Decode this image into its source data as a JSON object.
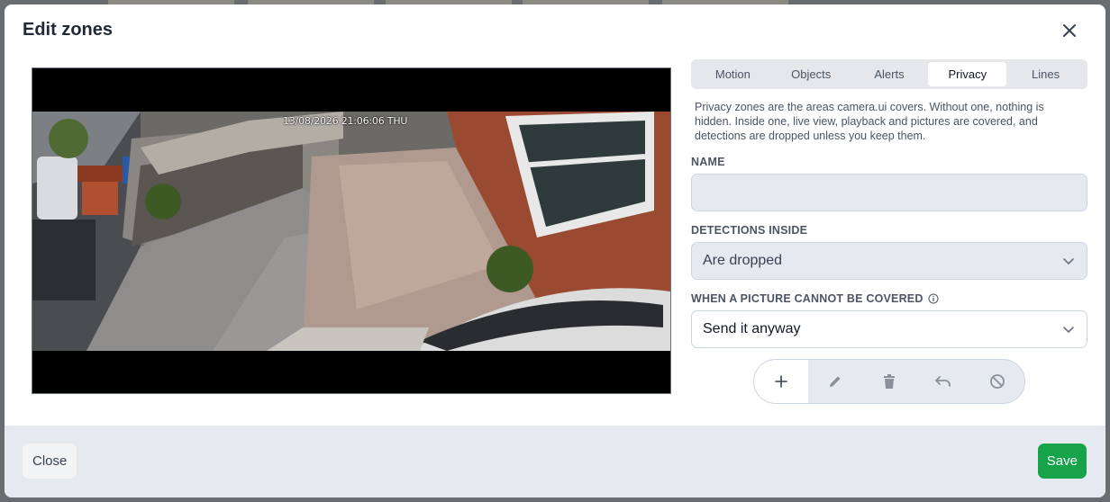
{
  "dialog": {
    "title": "Edit zones",
    "close_icon": "close-icon"
  },
  "preview": {
    "timestamp": "13/08/2026 21:06:06 THU"
  },
  "tabs": [
    {
      "label": "Motion",
      "active": false
    },
    {
      "label": "Objects",
      "active": false
    },
    {
      "label": "Alerts",
      "active": false
    },
    {
      "label": "Privacy",
      "active": true
    },
    {
      "label": "Lines",
      "active": false
    }
  ],
  "privacy": {
    "description": "Privacy zones are the areas camera.ui covers. Without one, nothing is hidden. Inside one, live view, playback and pictures are covered, and detections are dropped unless you keep them.",
    "name_label": "NAME",
    "name_value": "",
    "detections_label": "DETECTIONS INSIDE",
    "detections_value": "Are dropped",
    "cover_label": "WHEN A PICTURE CANNOT BE COVERED",
    "cover_value": "Send it anyway"
  },
  "toolbar": {
    "tools": [
      "plus-icon",
      "pencil-icon",
      "trash-icon",
      "undo-icon",
      "clear-icon"
    ]
  },
  "footer": {
    "close_label": "Close",
    "save_label": "Save"
  },
  "colors": {
    "accent": "#16a34a",
    "panel_bg": "#e5eaf0"
  }
}
